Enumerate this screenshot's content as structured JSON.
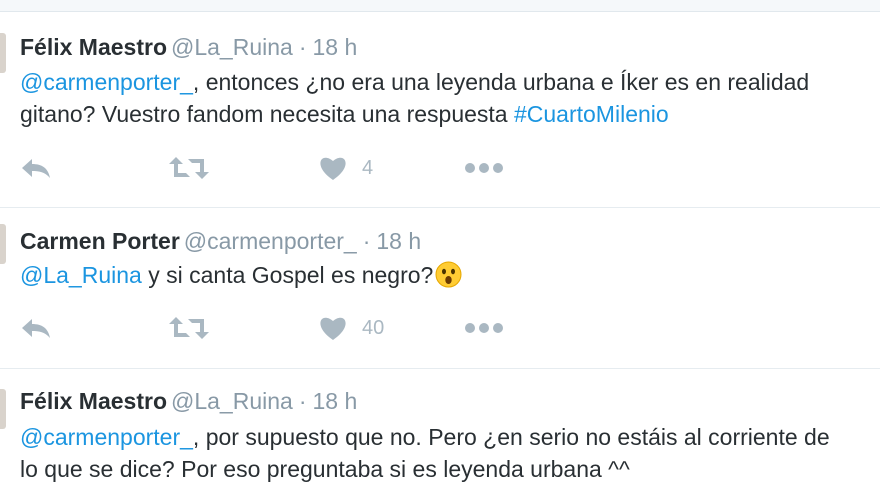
{
  "tweets": [
    {
      "name": "Félix Maestro",
      "handle": "@La_Ruina",
      "dot": "·",
      "time": "18 h",
      "line1_mention": "@carmenporter_",
      "line1_text": ", entonces ¿no era una leyenda urbana e Íker es en realidad",
      "line2_text": "gitano? Vuestro fandom necesita una respuesta ",
      "line2_hashtag": "#CuartoMilenio",
      "like_count": "4"
    },
    {
      "name": "Carmen Porter",
      "handle": "@carmenporter_",
      "dot": "·",
      "time": "18 h",
      "line1_mention": "@La_Ruina",
      "line1_text": " y si canta Gospel es negro?",
      "emoji": "astonished-face-emoji",
      "like_count": "40"
    },
    {
      "name": "Félix Maestro",
      "handle": "@La_Ruina",
      "dot": "·",
      "time": "18 h",
      "line1_mention": "@carmenporter_",
      "line1_text": ", por supuesto que no. Pero ¿en serio no estáis al corriente de",
      "line2_text": "lo que se dice? Por eso preguntaba si es leyenda urbana ^^"
    }
  ],
  "colors": {
    "link": "#1b95e0",
    "muted": "#8899a6",
    "icon": "#aab8c2",
    "text": "#292f33"
  },
  "icons": [
    "reply-icon",
    "retweet-icon",
    "heart-icon",
    "more-icon"
  ]
}
